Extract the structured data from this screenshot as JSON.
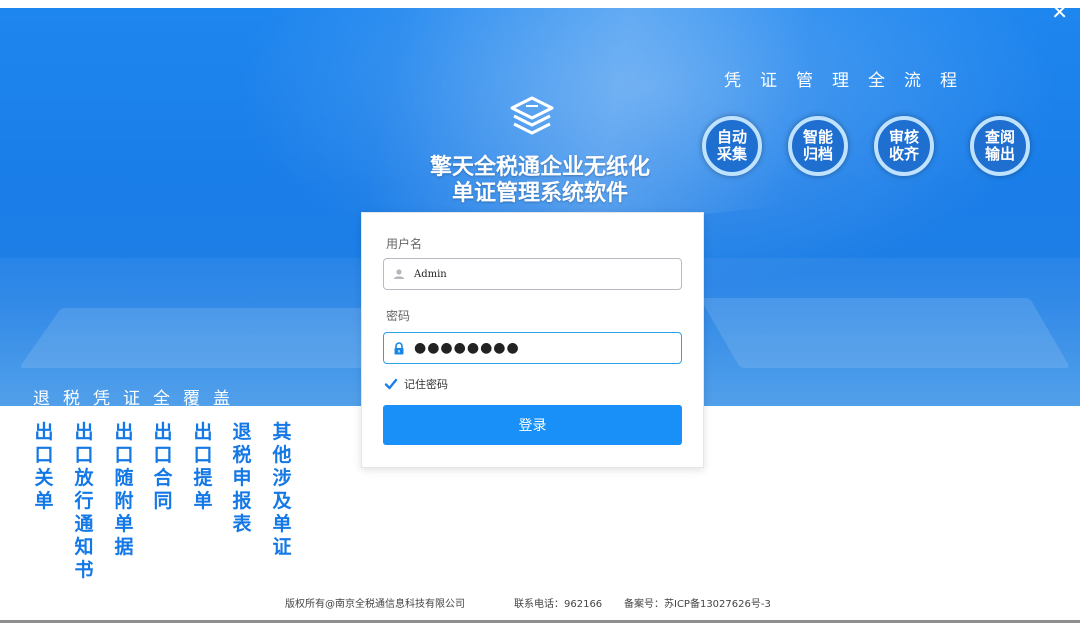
{
  "window": {
    "close_label": "✕"
  },
  "header": {
    "top_slogan": "凭证管理全流程",
    "features": [
      "自动采集",
      "智能归档",
      "审核收齐",
      "查阅输出"
    ],
    "title_line1": "擎天全税通企业无纸化",
    "title_line2": "单证管理系统软件",
    "bottom_slogan": "退税凭证全覆盖",
    "logo_icon": "layers-stack-icon"
  },
  "doc_types": [
    "出口关单",
    "出口放行通知书",
    "出口随附单据",
    "出口合同",
    "出口提单",
    "退税申报表",
    "其他涉及单证"
  ],
  "login": {
    "username_label": "用户名",
    "username_value": "Admin",
    "password_label": "密码",
    "password_value": "●●●●●●●●",
    "remember_label": "记住密码",
    "remember_checked": true,
    "submit_label": "登录",
    "user_icon": "user-icon",
    "lock_icon": "lock-icon"
  },
  "footer": {
    "copyright": "版权所有@南京全税通信息科技有限公司",
    "phone": "联系电话：962166",
    "icp": "备案号：苏ICP备13027626号-3"
  },
  "colors": {
    "primary": "#1890f7",
    "banner": "#1e86ef",
    "doc_text": "#1478e6"
  }
}
